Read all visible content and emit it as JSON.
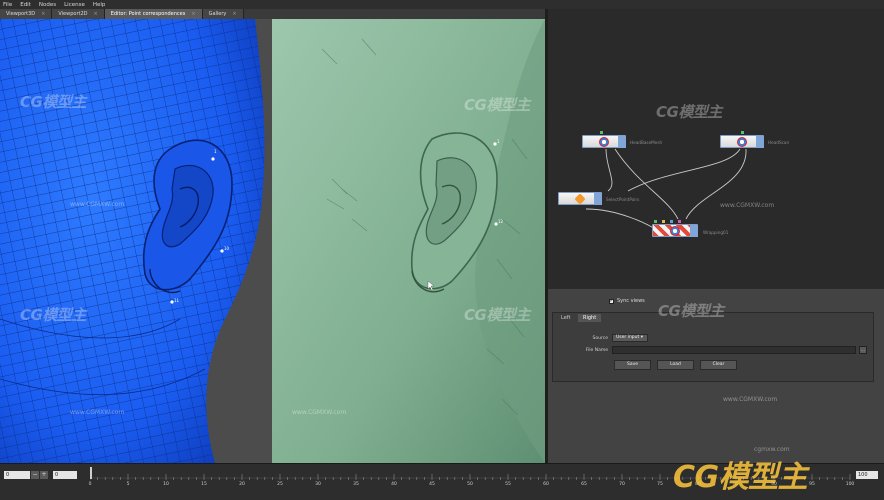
{
  "menu": [
    "File",
    "Edit",
    "Nodes",
    "License",
    "Help"
  ],
  "tabs": [
    {
      "label": "Viewport3D"
    },
    {
      "label": "Viewport2D"
    },
    {
      "label": "Editor: Point correspondences"
    },
    {
      "label": "Gallery"
    }
  ],
  "nodes": {
    "head_base_mesh": "HeadBaseMesh",
    "head_scan": "HeadScan",
    "select_points": "SelectPointPairs",
    "wrapping": "Wrapping01"
  },
  "points": {
    "p1": "1",
    "p2": "10",
    "p3": "11",
    "p4": "12"
  },
  "props": {
    "sync_label": "Sync views",
    "tab_left": "Left",
    "tab_right": "Right",
    "source_label": "Source",
    "source_value": "User input",
    "file_label": "File Name",
    "browse": "...",
    "save": "Save",
    "load": "Load",
    "clear": "Clear"
  },
  "timeline": {
    "start": "0",
    "current": "0",
    "end": "100",
    "ticks": [
      "0",
      "5",
      "10",
      "15",
      "20",
      "25",
      "30",
      "35",
      "40",
      "45",
      "50",
      "55",
      "60",
      "65",
      "70",
      "75",
      "80",
      "85",
      "90",
      "95",
      "100"
    ]
  },
  "watermark": {
    "text": "CG模型主",
    "site": "www.CGMXW.com",
    "site_small": "cgmxw.com"
  }
}
